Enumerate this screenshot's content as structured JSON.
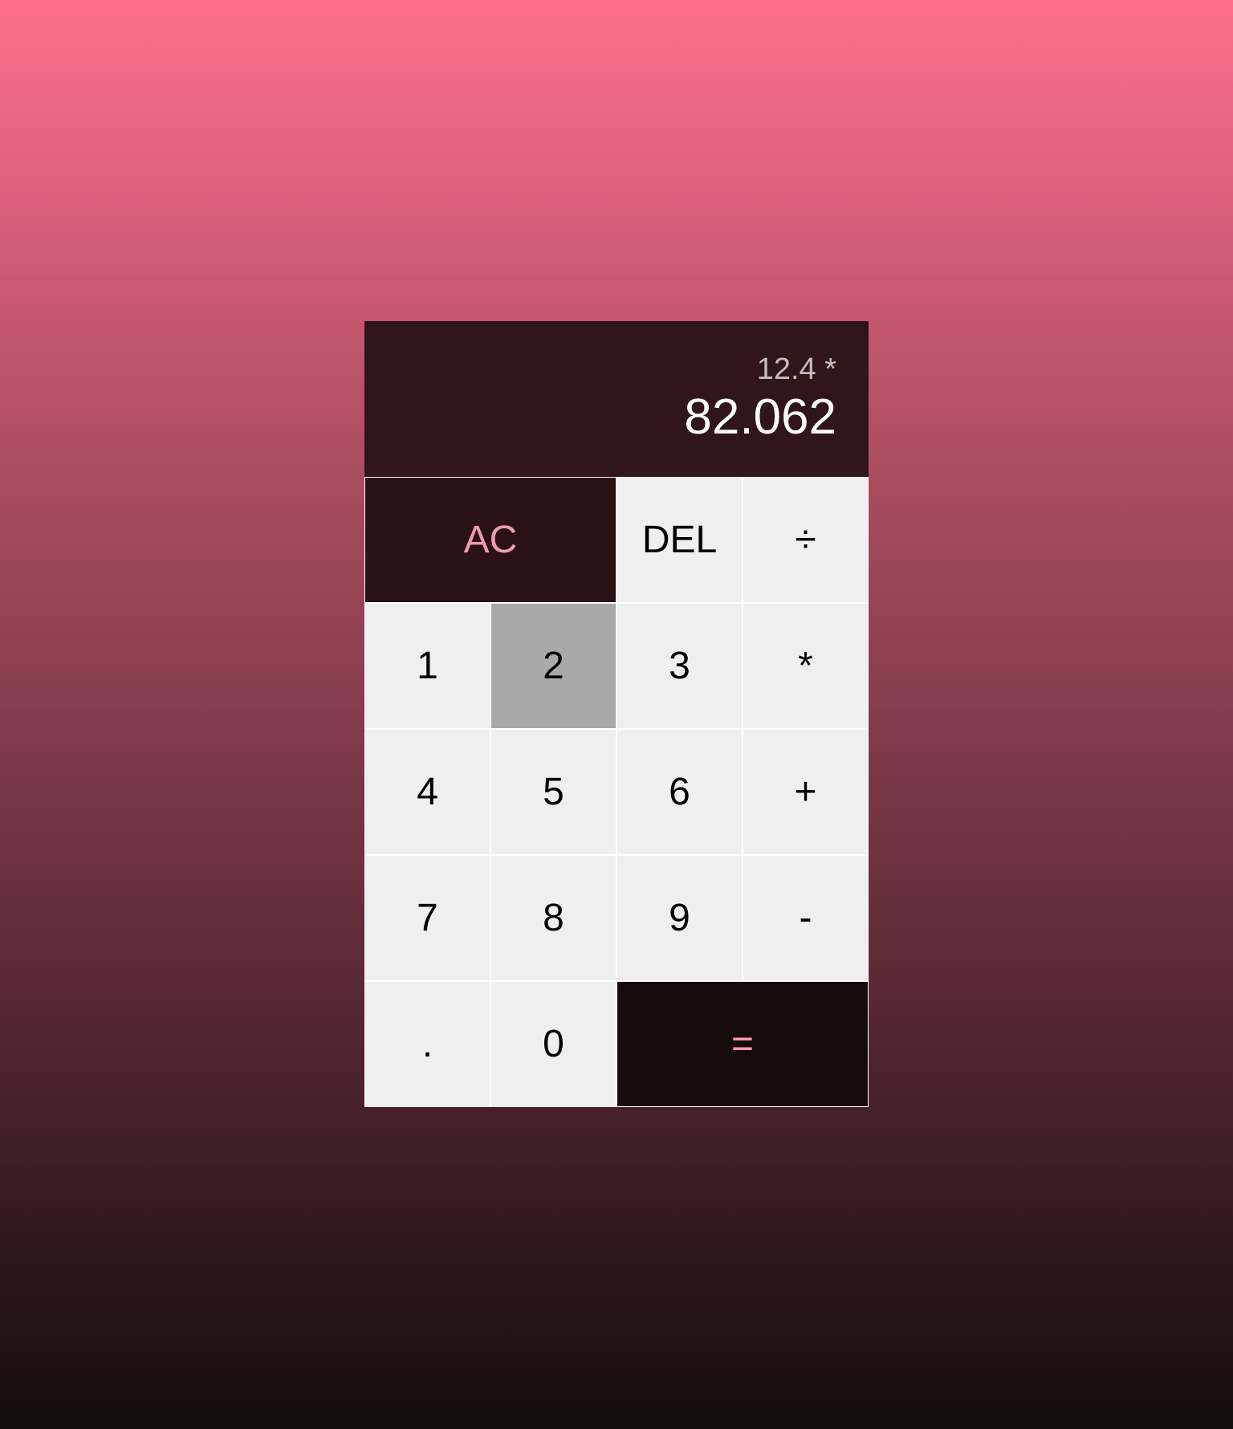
{
  "display": {
    "previous": "12.4 *",
    "current": "82.062"
  },
  "keys": {
    "ac": "AC",
    "del": "DEL",
    "divide": "÷",
    "one": "1",
    "two": "2",
    "three": "3",
    "multiply": "*",
    "four": "4",
    "five": "5",
    "six": "6",
    "plus": "+",
    "seven": "7",
    "eight": "8",
    "nine": "9",
    "minus": "-",
    "dot": ".",
    "zero": "0",
    "equals": "="
  },
  "colors": {
    "display_bg": "#30151b",
    "accent_text": "#f29ab3",
    "key_bg": "#efefef",
    "pressed_key_bg": "#a9a9a9"
  }
}
